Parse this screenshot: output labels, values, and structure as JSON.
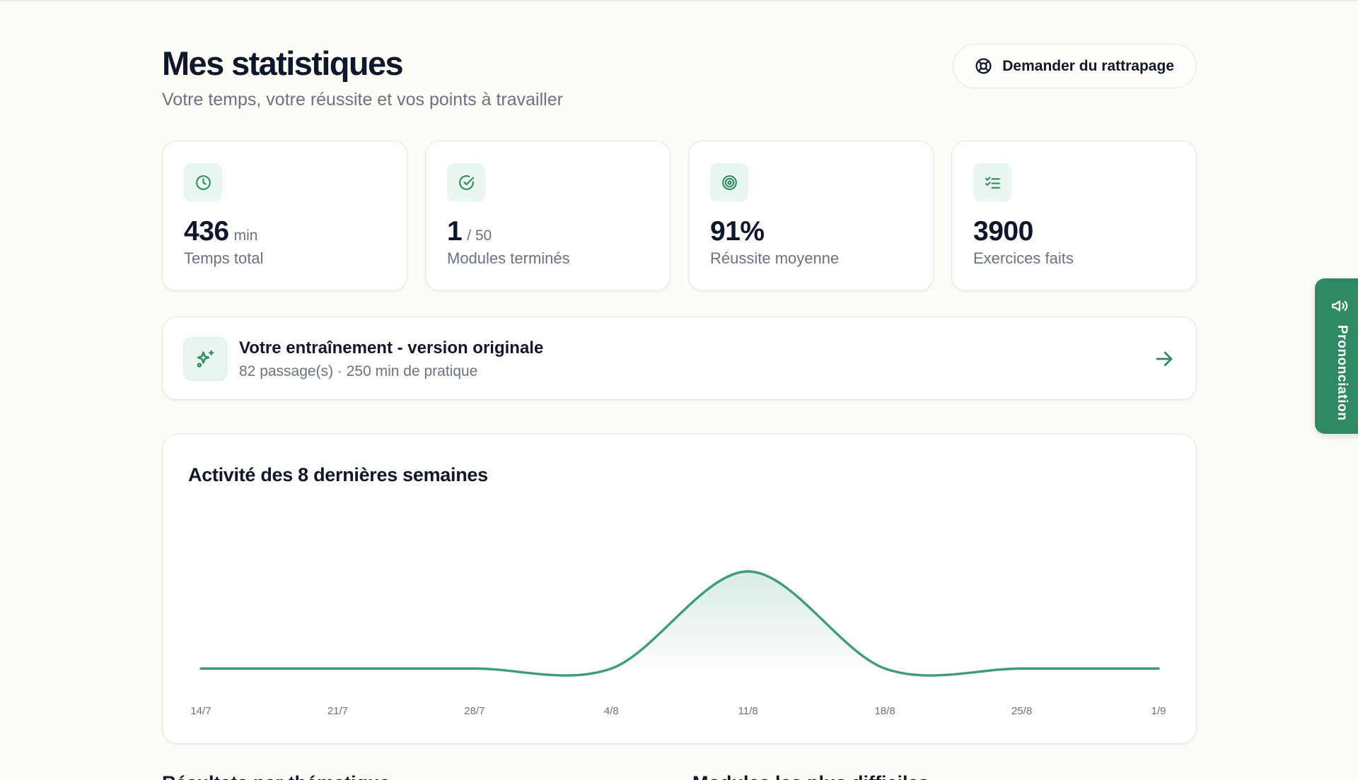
{
  "header": {
    "title": "Mes statistiques",
    "subtitle": "Votre temps, votre réussite et vos points à travailler",
    "rescue_button": "Demander du rattrapage"
  },
  "stats": [
    {
      "value": "436",
      "unit": "min",
      "label": "Temps total",
      "icon": "clock-icon"
    },
    {
      "value": "1",
      "unit": "/ 50",
      "label": "Modules terminés",
      "icon": "check-circle-icon"
    },
    {
      "value": "91%",
      "unit": "",
      "label": "Réussite moyenne",
      "icon": "target-icon"
    },
    {
      "value": "3900",
      "unit": "",
      "label": "Exercices faits",
      "icon": "list-checks-icon"
    }
  ],
  "training": {
    "title": "Votre entraînement - version originale",
    "subtitle": "82 passage(s) · 250 min de pratique",
    "icon": "sparkles-icon"
  },
  "chart_data": {
    "type": "area",
    "title": "Activité des 8 dernières semaines",
    "categories": [
      "14/7",
      "21/7",
      "28/7",
      "4/8",
      "11/8",
      "18/8",
      "25/8",
      "1/9"
    ],
    "values": [
      0,
      0,
      0,
      0,
      100,
      0,
      0,
      0
    ],
    "ylim": [
      -10,
      110
    ],
    "grid": false,
    "color": "#3f9b7c"
  },
  "sections": {
    "left": "Résultats par thématique",
    "right": "Modules les plus difficiles"
  },
  "side_tab": {
    "label": "Prononciation",
    "icon": "megaphone-icon"
  },
  "colors": {
    "background": "#fefcf7",
    "accent": "#2f8a63",
    "icon_bg": "#e9f5ef"
  }
}
